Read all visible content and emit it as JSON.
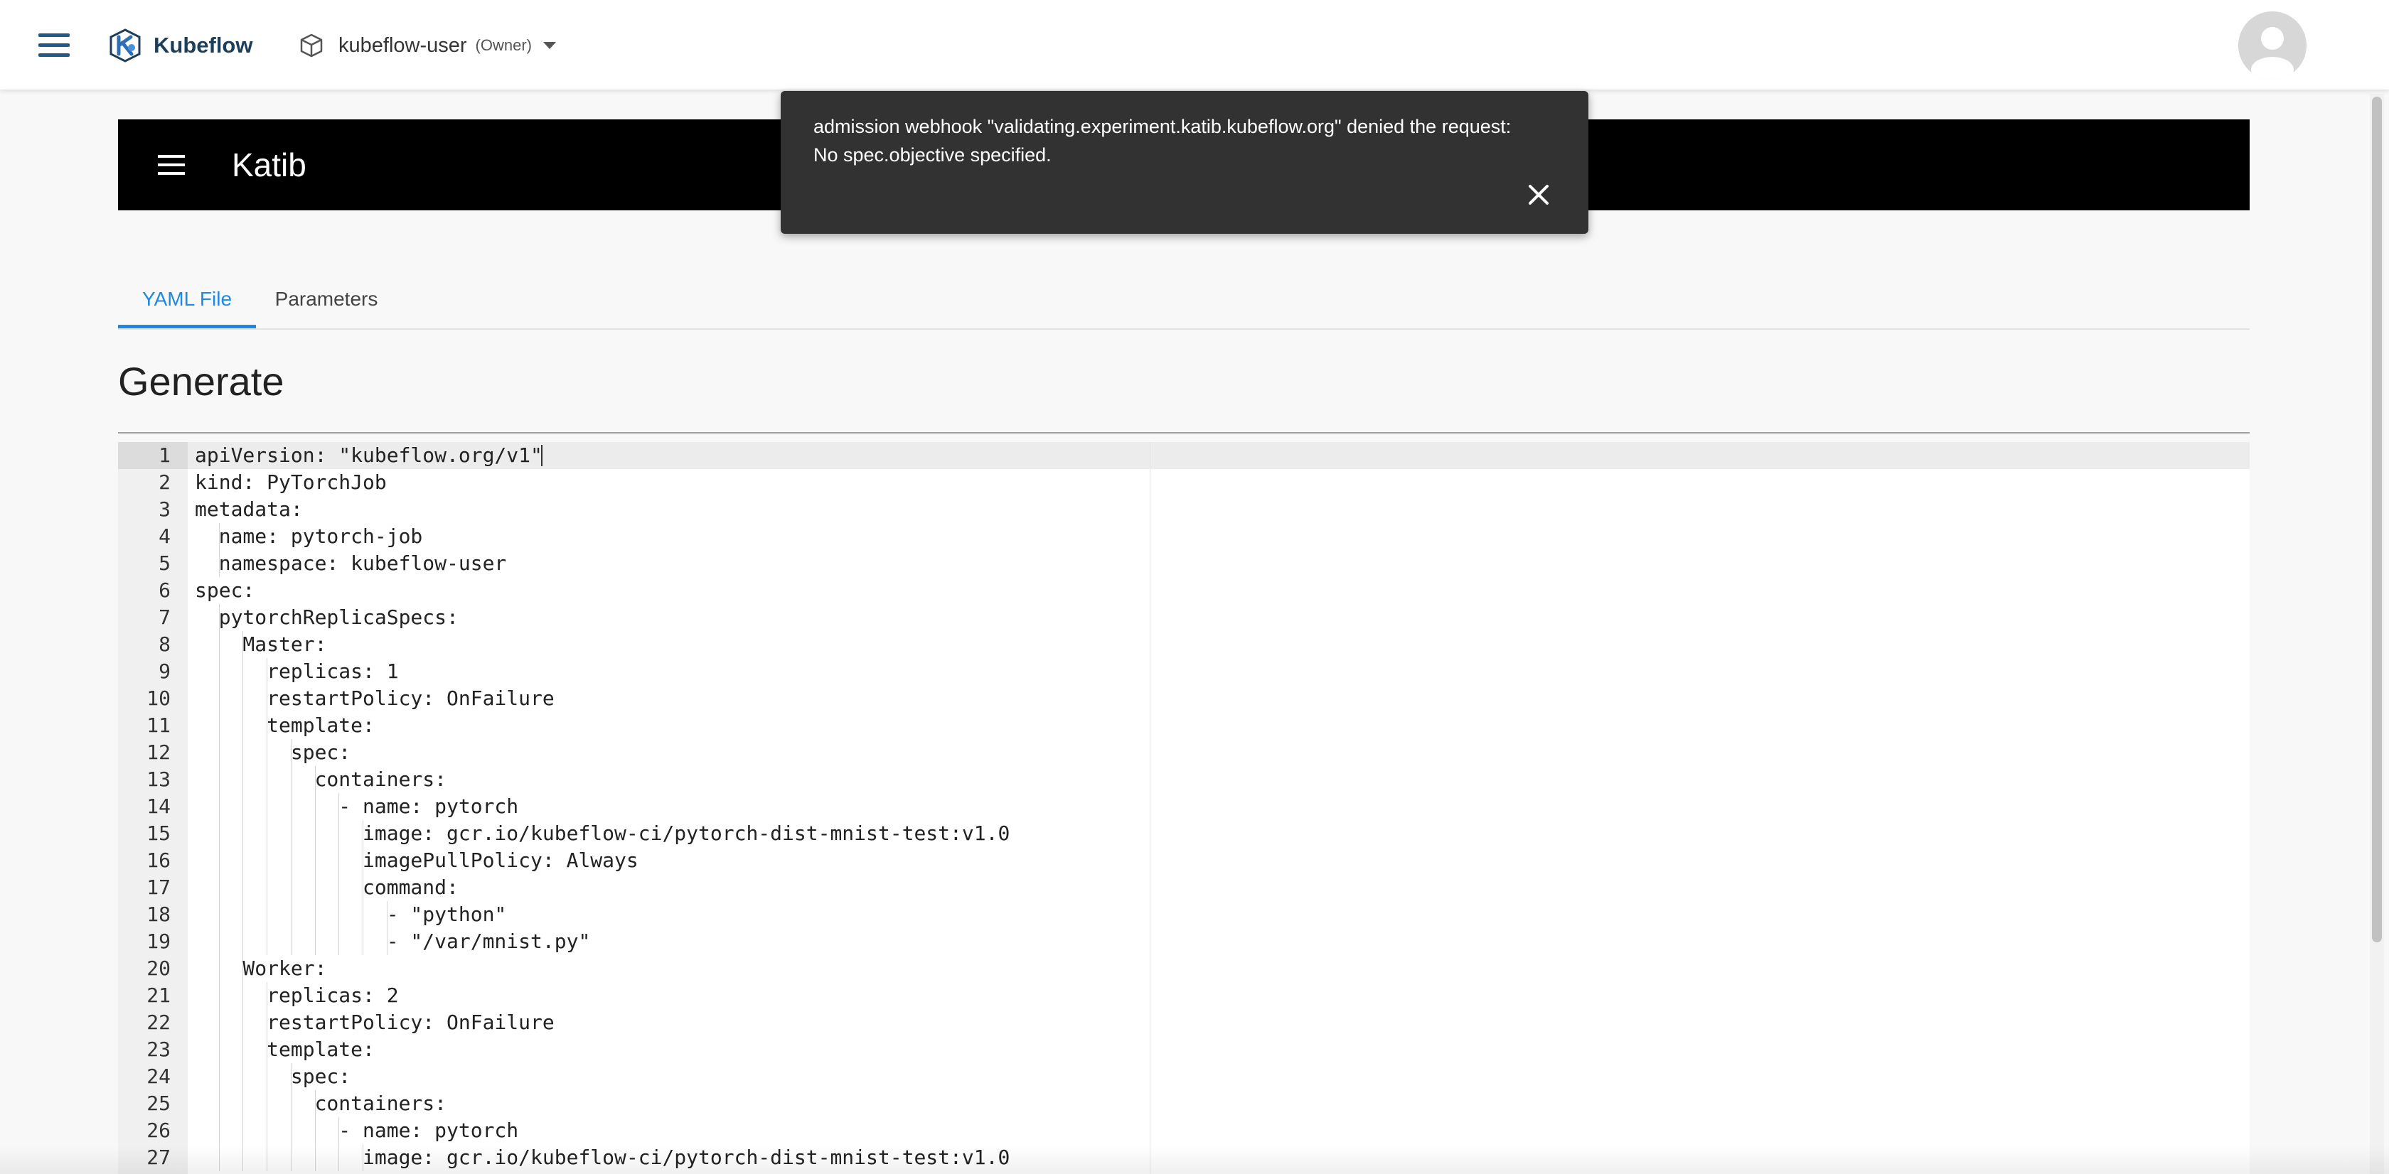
{
  "header": {
    "app_name": "Kubeflow",
    "namespace": "kubeflow-user",
    "role": "(Owner)",
    "icons": {
      "menu": "hamburger-menu-icon",
      "logo": "kubeflow-logo-icon",
      "namespace": "cube-icon",
      "dropdown": "chevron-down-icon",
      "avatar": "user-avatar-icon"
    }
  },
  "katib": {
    "title": "Katib"
  },
  "snackbar": {
    "message": "admission webhook \"validating.experiment.katib.kubeflow.org\" denied the request: No spec.objective specified.",
    "close_icon": "close-icon"
  },
  "tabs": [
    {
      "label": "YAML File",
      "active": true
    },
    {
      "label": "Parameters",
      "active": false
    }
  ],
  "section_title": "Generate",
  "editor": {
    "lines": [
      {
        "n": "1",
        "text": "apiVersion: \"kubeflow.org/v1\""
      },
      {
        "n": "2",
        "text": "kind: PyTorchJob"
      },
      {
        "n": "3",
        "text": "metadata:"
      },
      {
        "n": "4",
        "text": "  name: pytorch-job"
      },
      {
        "n": "5",
        "text": "  namespace: kubeflow-user"
      },
      {
        "n": "6",
        "text": "spec:"
      },
      {
        "n": "7",
        "text": "  pytorchReplicaSpecs:"
      },
      {
        "n": "8",
        "text": "    Master:"
      },
      {
        "n": "9",
        "text": "      replicas: 1"
      },
      {
        "n": "10",
        "text": "      restartPolicy: OnFailure"
      },
      {
        "n": "11",
        "text": "      template:"
      },
      {
        "n": "12",
        "text": "        spec:"
      },
      {
        "n": "13",
        "text": "          containers:"
      },
      {
        "n": "14",
        "text": "            - name: pytorch"
      },
      {
        "n": "15",
        "text": "              image: gcr.io/kubeflow-ci/pytorch-dist-mnist-test:v1.0"
      },
      {
        "n": "16",
        "text": "              imagePullPolicy: Always"
      },
      {
        "n": "17",
        "text": "              command:"
      },
      {
        "n": "18",
        "text": "                - \"python\""
      },
      {
        "n": "19",
        "text": "                - \"/var/mnist.py\""
      },
      {
        "n": "20",
        "text": "    Worker:"
      },
      {
        "n": "21",
        "text": "      replicas: 2"
      },
      {
        "n": "22",
        "text": "      restartPolicy: OnFailure"
      },
      {
        "n": "23",
        "text": "      template:"
      },
      {
        "n": "24",
        "text": "        spec:"
      },
      {
        "n": "25",
        "text": "          containers:"
      },
      {
        "n": "26",
        "text": "            - name: pytorch"
      },
      {
        "n": "27",
        "text": "              image: gcr.io/kubeflow-ci/pytorch-dist-mnist-test:v1.0"
      }
    ]
  },
  "colors": {
    "accent": "#1e88e5",
    "brand": "#1d3e5b",
    "katib_bar": "#000000",
    "snackbar": "#323232"
  }
}
